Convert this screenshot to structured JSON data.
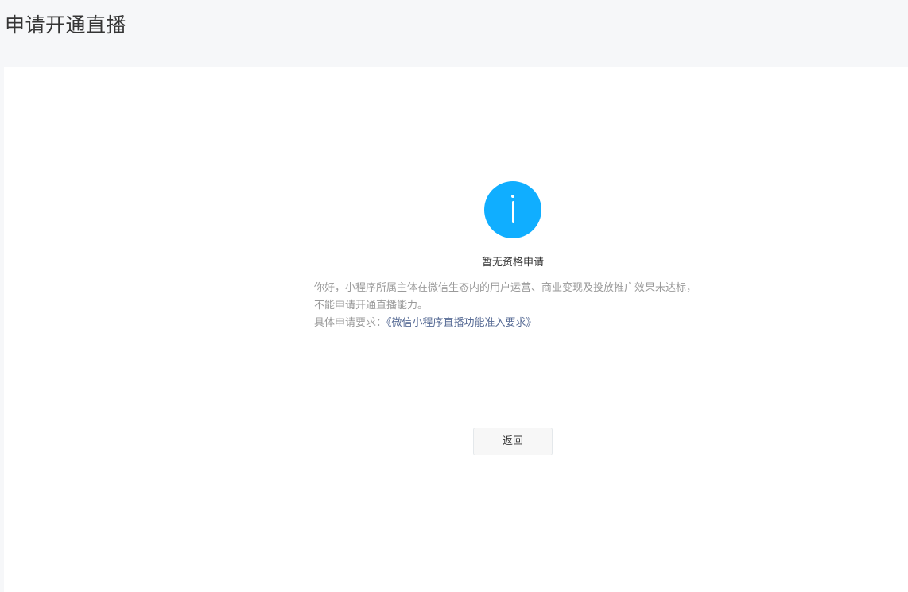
{
  "header": {
    "title": "申请开通直播"
  },
  "message": {
    "icon": "info-icon",
    "icon_color": "#10aeff",
    "title": "暂无资格申请",
    "description": "你好，小程序所属主体在微信生态内的用户运营、商业变现及投放推广效果未达标，不能申请开通直播能力。",
    "requirement_prefix": "具体申请要求：",
    "requirement_link": "《微信小程序直播功能准入要求》",
    "link_color": "#576b95"
  },
  "actions": {
    "back_label": "返回"
  }
}
